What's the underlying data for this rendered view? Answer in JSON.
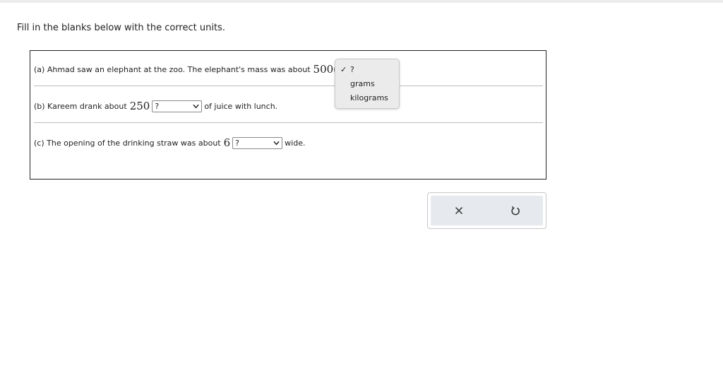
{
  "instructions": "Fill in the blanks below with the correct units.",
  "parts": [
    {
      "prefix": "(a) Ahmad saw an elephant at the zoo. The elephant's mass was about",
      "number": "500(",
      "selected": "",
      "suffix": ""
    },
    {
      "prefix": "(b) Kareem drank about",
      "number": "250",
      "selected": "?",
      "suffix": "of juice with lunch."
    },
    {
      "prefix": "(c) The opening of the drinking straw was about",
      "number": "6",
      "selected": "?",
      "suffix": "wide."
    }
  ],
  "dropdown": {
    "selected_option": "?",
    "check_mark": "✓",
    "options": [
      "grams",
      "kilograms"
    ]
  },
  "actions": {
    "clear_icon": "x-icon",
    "undo_icon": "undo-icon"
  }
}
